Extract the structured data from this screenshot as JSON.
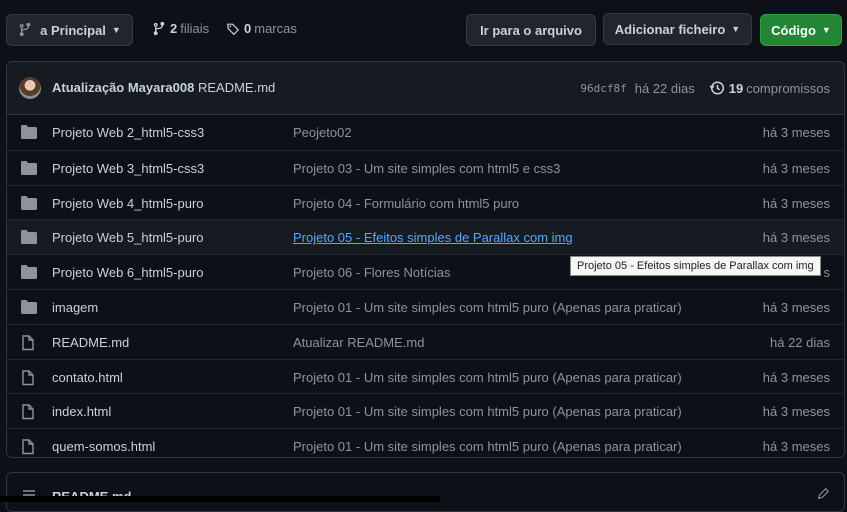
{
  "toolbar": {
    "branch_label": "a Principal",
    "branches_count": "2",
    "branches_label": "filiais",
    "tags_count": "0",
    "tags_label": "marcas",
    "go_to_file": "Ir para o arquivo",
    "add_file": "Adicionar ficheiro",
    "code": "Código"
  },
  "commit": {
    "author": "Atualização Mayara008",
    "message": "README.md",
    "sha": "96dcf8f",
    "age": "há 22 dias",
    "count": "19",
    "count_label": "compromissos"
  },
  "files": [
    {
      "type": "folder",
      "name": "Projeto Web 2_html5-css3",
      "message": "Peojeto02",
      "age": "há 3 meses"
    },
    {
      "type": "folder",
      "name": "Projeto Web 3_html5-css3",
      "message": "Projeto 03 - Um site simples com html5 e css3",
      "age": "há 3 meses"
    },
    {
      "type": "folder",
      "name": "Projeto Web 4_html5-puro",
      "message": "Projeto 04 - Formulário com html5 puro",
      "age": "há 3 meses"
    },
    {
      "type": "folder",
      "name": "Projeto Web 5_html5-puro",
      "message": "Projeto 05 - Efeitos simples de Parallax com img",
      "age": "há 3 meses"
    },
    {
      "type": "folder",
      "name": "Projeto Web 6_html5-puro",
      "message": "Projeto 06 - Flores Notícias",
      "age": "s"
    },
    {
      "type": "folder",
      "name": "imagem",
      "message": "Projeto 01 - Um site simples com html5 puro (Apenas para praticar)",
      "age": "há 3 meses"
    },
    {
      "type": "file",
      "name": "README.md",
      "message": "Atualizar README.md",
      "age": "há 22 dias"
    },
    {
      "type": "file",
      "name": "contato.html",
      "message": "Projeto 01 - Um site simples com html5 puro (Apenas para praticar)",
      "age": "há 3 meses"
    },
    {
      "type": "file",
      "name": "index.html",
      "message": "Projeto 01 - Um site simples com html5 puro (Apenas para praticar)",
      "age": "há 3 meses"
    },
    {
      "type": "file",
      "name": "quem-somos.html",
      "message": "Projeto 01 - Um site simples com html5 puro (Apenas para praticar)",
      "age": "há 3 meses"
    }
  ],
  "tooltip": "Projeto 05 - Efeitos simples de Parallax com img",
  "readme": {
    "title": "README.md"
  },
  "colors": {
    "accent_green": "#238636",
    "link": "#58a6ff",
    "bg": "#0d1117"
  }
}
